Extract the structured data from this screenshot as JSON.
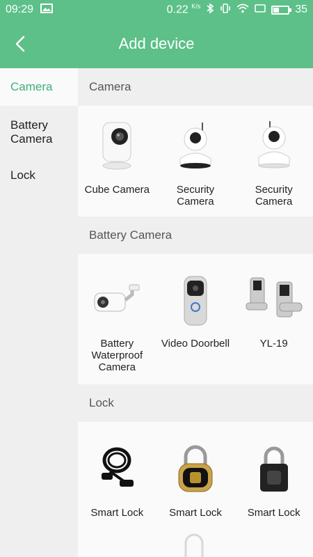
{
  "status_bar": {
    "time": "09:29",
    "speed": "0.22",
    "speed_unit": "K/s",
    "battery": "35",
    "battery_level": 0.35
  },
  "header": {
    "title": "Add device"
  },
  "sidebar": {
    "items": [
      {
        "label": "Camera"
      },
      {
        "label": "Battery\nCamera"
      },
      {
        "label": "Lock"
      }
    ]
  },
  "sections": [
    {
      "title": "Camera",
      "devices": [
        {
          "label": "Cube Camera",
          "icon": "cube-camera-icon"
        },
        {
          "label": "Security\nCamera",
          "icon": "security-camera-icon"
        },
        {
          "label": "Security\nCamera",
          "icon": "security-camera-icon"
        }
      ]
    },
    {
      "title": "Battery Camera",
      "devices": [
        {
          "label": "Battery\nWaterproof\nCamera",
          "icon": "bullet-camera-icon"
        },
        {
          "label": "Video Doorbell",
          "icon": "video-doorbell-icon"
        },
        {
          "label": "YL-19",
          "icon": "door-lock-icon"
        }
      ]
    },
    {
      "title": "Lock",
      "devices": [
        {
          "label": "Smart Lock",
          "icon": "cable-lock-icon"
        },
        {
          "label": "Smart Lock",
          "icon": "gold-padlock-icon"
        },
        {
          "label": "Smart Lock",
          "icon": "black-padlock-icon"
        }
      ]
    }
  ]
}
